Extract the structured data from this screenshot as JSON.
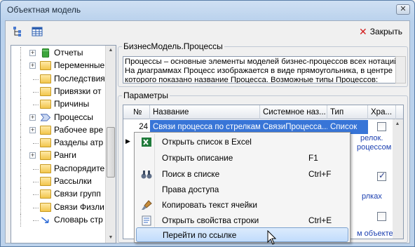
{
  "window": {
    "title": "Объектная модель",
    "close_glyph": "✕"
  },
  "toolbar": {
    "close_label": "Закрыть",
    "icons": [
      "tree-structure-icon",
      "table-grid-icon"
    ]
  },
  "tree": {
    "items": [
      {
        "label": "Отчеты",
        "icon": "green-db-icon",
        "expandable": true
      },
      {
        "label": "Переменные",
        "icon": "folder-icon",
        "expandable": true
      },
      {
        "label": "Последствия",
        "icon": "folder-icon",
        "expandable": false
      },
      {
        "label": "Привязки от",
        "icon": "folder-icon",
        "expandable": false
      },
      {
        "label": "Причины",
        "icon": "folder-icon",
        "expandable": false
      },
      {
        "label": "Процессы",
        "icon": "process-arrow-icon",
        "expandable": true
      },
      {
        "label": "Рабочее вре",
        "icon": "folder-icon",
        "expandable": true
      },
      {
        "label": "Разделы атр",
        "icon": "folder-icon",
        "expandable": false
      },
      {
        "label": "Ранги",
        "icon": "folder-icon",
        "expandable": true
      },
      {
        "label": "Распорядите",
        "icon": "folder-icon",
        "expandable": false
      },
      {
        "label": "Рассылки",
        "icon": "folder-icon",
        "expandable": false
      },
      {
        "label": "Связи групп",
        "icon": "folder-icon",
        "expandable": false
      },
      {
        "label": "Связи Физли",
        "icon": "folder-icon",
        "expandable": false
      },
      {
        "label": "Словарь стр",
        "icon": "link-arrow-icon",
        "expandable": false
      }
    ]
  },
  "object_group": {
    "label": "БизнесМодель.Процессы",
    "description": "Процессы – основные элементы моделей бизнес-процессов всех нотаций. На диаграммах Процесс изображается в виде прямоугольника, в центре которого показано название Процесса. Возможные типы Процессов:"
  },
  "params_group": {
    "label": "Параметры",
    "columns": [
      "№",
      "Название",
      "Системное наз...",
      "Тип",
      "Хра..."
    ],
    "selected_row": {
      "num": "24",
      "name": "Связи процесса по стрелкам",
      "sys": "СвязиПроцесса...",
      "type": "Список"
    },
    "background_fragments": [
      "релок.",
      "роцессом",
      "рлках",
      "м объекте."
    ]
  },
  "context_menu": {
    "items": [
      {
        "label": "Открыть список в Excel",
        "shortcut": "",
        "icon": "excel-icon"
      },
      {
        "label": "Открыть описание",
        "shortcut": "F1",
        "icon": ""
      },
      {
        "label": "Поиск в списке",
        "shortcut": "Ctrl+F",
        "icon": "binoculars-icon"
      },
      {
        "label": "Права доступа",
        "shortcut": "",
        "icon": ""
      },
      {
        "label": "Копировать текст ячейки",
        "shortcut": "",
        "icon": "brush-icon"
      },
      {
        "label": "Открыть свойства строки",
        "shortcut": "Ctrl+E",
        "icon": "properties-icon"
      },
      {
        "label": "Перейти по ссылке",
        "shortcut": "",
        "icon": ""
      }
    ],
    "highlighted_index": 6
  },
  "colors": {
    "selection": "#3875d7",
    "link_text": "#1b3fb0",
    "close_red": "#d21c1c"
  }
}
